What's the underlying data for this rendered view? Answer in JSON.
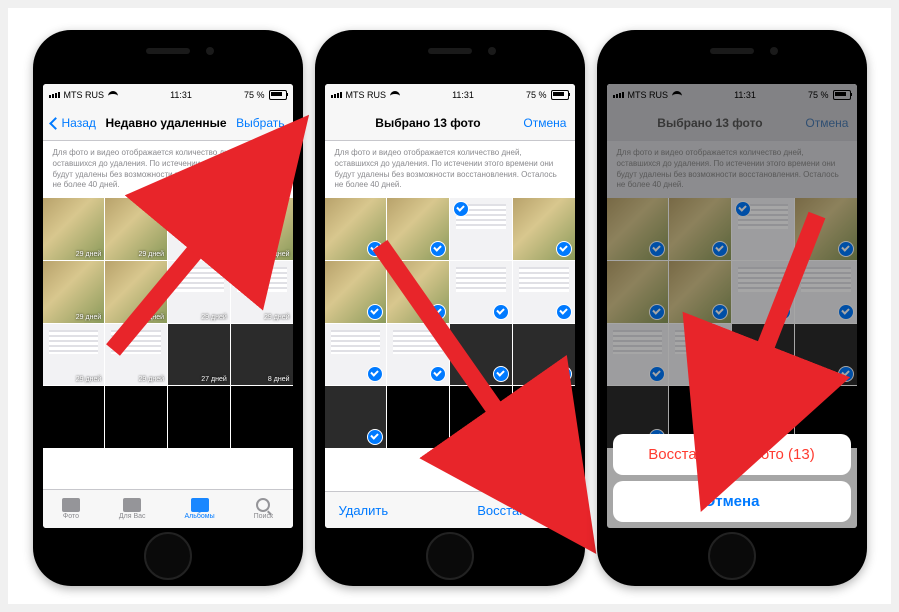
{
  "status": {
    "carrier": "MTS RUS",
    "time": "11:31",
    "battery": "75 %"
  },
  "phone1": {
    "back": "Назад",
    "title": "Недавно удаленные",
    "select": "Выбрать",
    "info": "Для фото и видео отображается количество дней, оставшихся до удаления. По истечении этого времени они будут удалены без возможности восстановления. Осталось не более 40 дней.",
    "tabs": [
      "Фото",
      "Для Вас",
      "Альбомы",
      "Поиск"
    ],
    "cells": [
      "29 дней",
      "29 дней",
      "29 дней",
      "29 дней",
      "29 дней",
      "29 дней",
      "29 дней",
      "29 дней",
      "29 дней",
      "29 дней",
      "27 дней",
      "8 дней"
    ]
  },
  "phone2": {
    "title": "Выбрано 13 фото",
    "cancel": "Отмена",
    "info": "Для фото и видео отображается количество дней, оставшихся до удаления. По истечении этого времени они будут удалены без возможности восстановления. Осталось не более 40 дней.",
    "delete": "Удалить",
    "recover": "Восстановить"
  },
  "phone3": {
    "title": "Выбрано 13 фото",
    "cancel": "Отмена",
    "info": "Для фото и видео отображается количество дней, оставшихся до удаления. По истечении этого времени они будут удалены без возможности восстановления. Осталось не более 40 дней.",
    "sheet_recover": "Восстановить фото (13)",
    "sheet_cancel": "Отмена"
  },
  "colors": {
    "accent": "#007aff",
    "destructive": "#ff3b30",
    "arrow": "#e8252a"
  }
}
